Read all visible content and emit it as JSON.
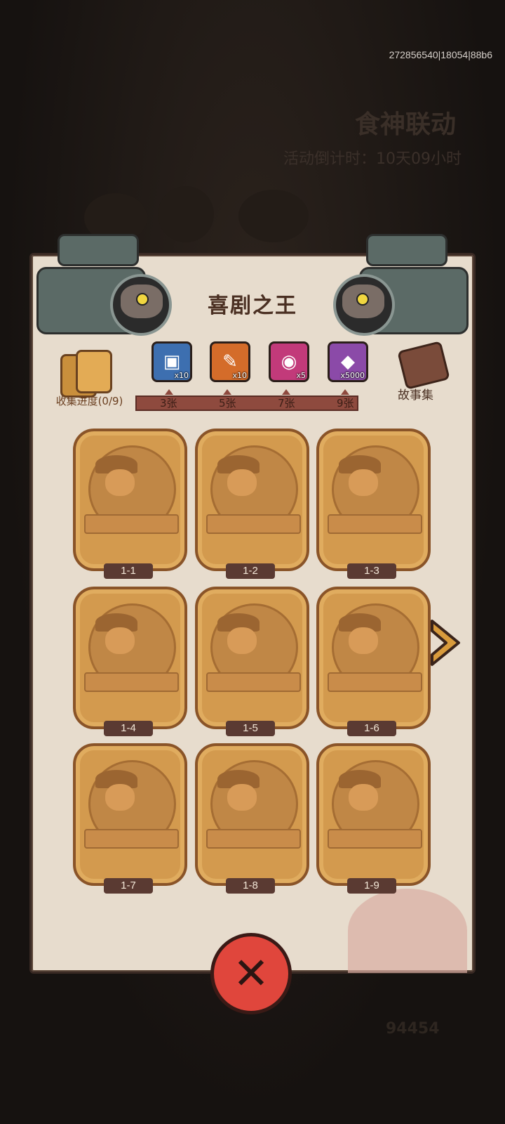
{
  "debug_info": "272856540|18054|88b6",
  "background": {
    "event_title": "食神联动",
    "countdown": "活动倒计时：10天09小时",
    "coins": "94454"
  },
  "panel": {
    "title": "喜剧之王",
    "progress_label": "收集进度(0/9)",
    "progress_fraction": 0,
    "storybook_label": "故事集"
  },
  "rewards": [
    {
      "icon": "treasure-chest-icon",
      "qty": "x10",
      "tier": "3张",
      "color": "#3d6fb0"
    },
    {
      "icon": "scroll-key-icon",
      "qty": "x10",
      "tier": "5张",
      "color": "#d46c2a"
    },
    {
      "icon": "purple-orb-icon",
      "qty": "x5",
      "tier": "7张",
      "color": "#c23a7a"
    },
    {
      "icon": "crystal-gem-icon",
      "qty": "x5000",
      "tier": "9张",
      "color": "#8b4aa8"
    }
  ],
  "cards": [
    {
      "label": "1-1"
    },
    {
      "label": "1-2"
    },
    {
      "label": "1-3"
    },
    {
      "label": "1-4"
    },
    {
      "label": "1-5"
    },
    {
      "label": "1-6"
    },
    {
      "label": "1-7"
    },
    {
      "label": "1-8"
    },
    {
      "label": "1-9"
    }
  ]
}
